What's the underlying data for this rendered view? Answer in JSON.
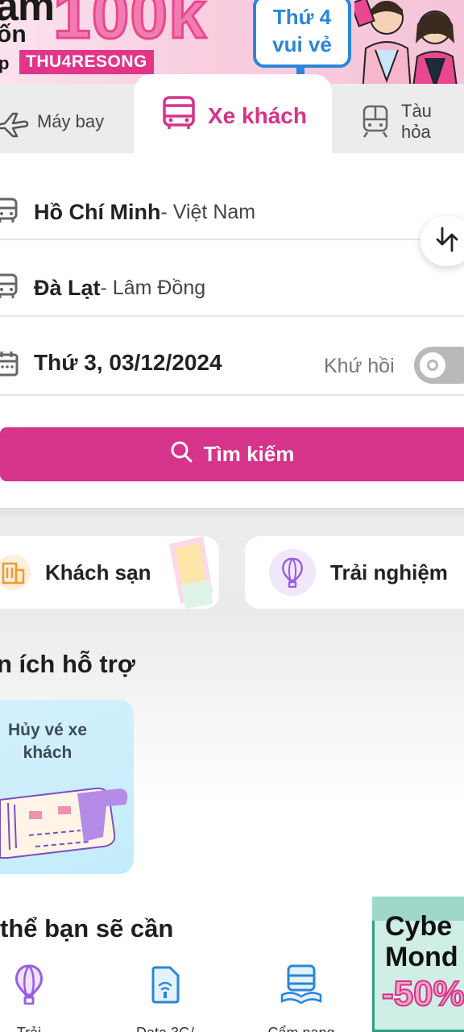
{
  "banner": {
    "title_line1": "ảm",
    "title_line2": "ốn",
    "amount": "100k",
    "code_prefix": "p",
    "code": "THU4RESONG",
    "sign_line1": "Thứ 4",
    "sign_line2": "vui vẻ"
  },
  "tabs": [
    {
      "label": "Máy bay",
      "icon": "airplane-icon"
    },
    {
      "label": "Xe khách",
      "icon": "bus-icon"
    },
    {
      "label": "Tàu hỏa",
      "icon": "train-icon"
    }
  ],
  "search": {
    "from_city": "Hồ Chí Minh",
    "from_region": " - Việt Nam",
    "to_city": "Đà Lạt",
    "to_region": " - Lâm Đồng",
    "date": "Thứ 3, 03/12/2024",
    "round_trip_label": "Khứ hồi",
    "round_trip_on": false,
    "button_label": "Tìm kiếm"
  },
  "quick_links": [
    {
      "label": "Khách sạn",
      "icon": "hotel-icon"
    },
    {
      "label": "Trải nghiệm",
      "icon": "hot-air-balloon-icon"
    }
  ],
  "support": {
    "title": "n ích hỗ trợ",
    "card_label": "Hủy vé xe khách"
  },
  "suggest": {
    "title": "thể bạn sẽ cần",
    "items": [
      {
        "label": "Trải",
        "icon": "hot-air-balloon-icon"
      },
      {
        "label": "Data 3G/",
        "icon": "sim-card-icon"
      },
      {
        "label": "Cẩm nang",
        "icon": "bus-guide-icon"
      }
    ]
  },
  "promo": {
    "line1": "Cybe",
    "line2": "Mond",
    "sale": "-50%"
  },
  "colors": {
    "brand": "#d6338a",
    "brand_light": "#f27bb0",
    "sign_blue": "#2a86d8",
    "hotel_orange": "#f29a2e",
    "balloon_purple": "#9b5de5"
  }
}
